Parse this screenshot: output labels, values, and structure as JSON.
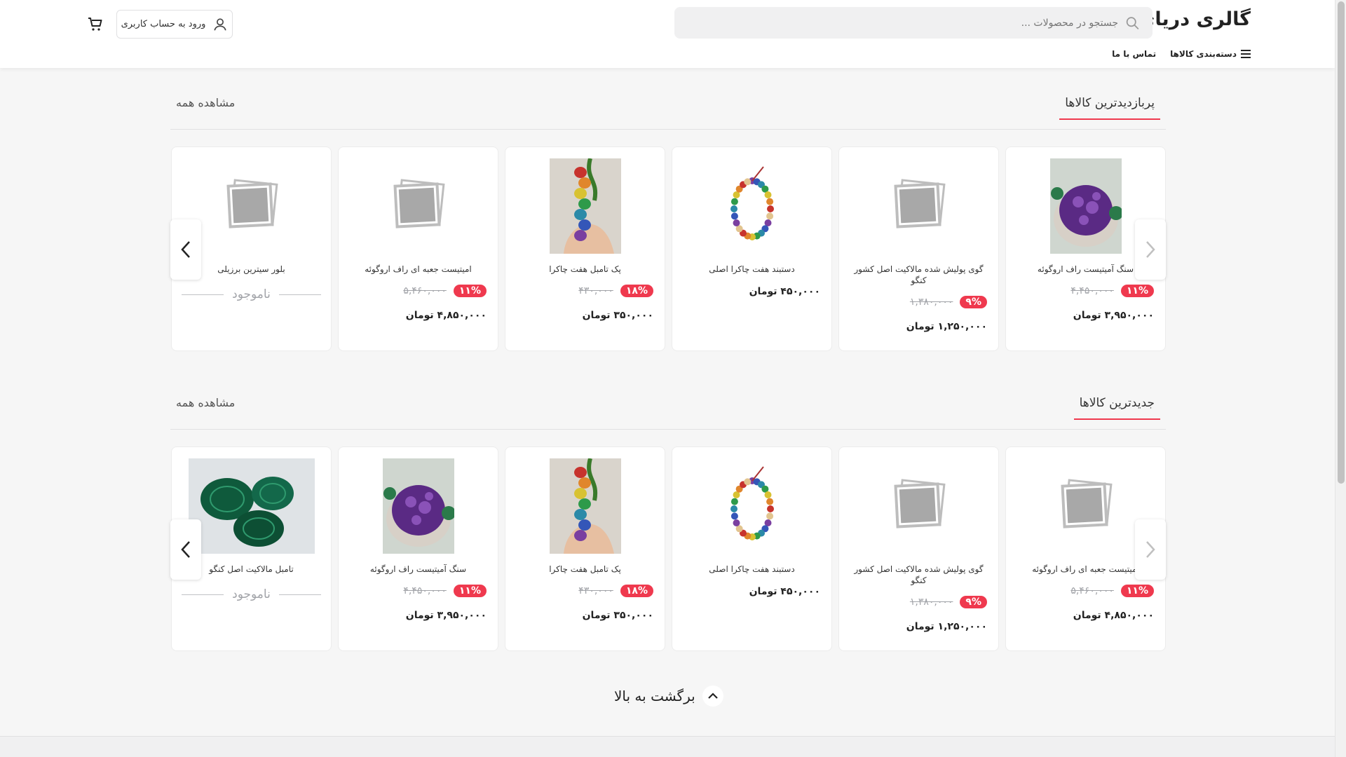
{
  "header": {
    "logo": "گالری دریای نور",
    "search_placeholder": "جستجو در محصولات ...",
    "categories_label": "دسته‌بندی کالاها",
    "contact_label": "تماس با ما",
    "login_label": "ورود به حساب کاربری"
  },
  "sections": [
    {
      "title": "پربازدیدترین کالاها",
      "view_all": "مشاهده همه",
      "products": [
        {
          "name": "سنگ آمیتیست راف اروگوئه",
          "image": "amethyst",
          "discount": "۱۱%",
          "old_price": "۴,۴۵۰,۰۰۰",
          "price": "۳,۹۵۰,۰۰۰ تومان"
        },
        {
          "name": "گوی پولیش شده مالاکیت اصل کشور کنگو",
          "image": "placeholder",
          "discount": "۹%",
          "old_price": "۱,۳۸۰,۰۰۰",
          "price": "۱,۲۵۰,۰۰۰ تومان"
        },
        {
          "name": "دستبند هفت چاکرا اصلی",
          "image": "bracelet",
          "discount": "",
          "old_price": "",
          "price": "۴۵۰,۰۰۰ تومان"
        },
        {
          "name": "پک تامبل هفت چاکرا",
          "image": "chakra",
          "discount": "۱۸%",
          "old_price": "۴۳۰,۰۰۰",
          "price": "۳۵۰,۰۰۰ تومان"
        },
        {
          "name": "امیتیست جعبه ای راف اروگوئه",
          "image": "placeholder",
          "discount": "۱۱%",
          "old_price": "۵,۴۶۰,۰۰۰",
          "price": "۴,۸۵۰,۰۰۰ تومان"
        },
        {
          "name": "بلور سیترین برزیلی",
          "image": "placeholder",
          "out_of_stock": "ناموجود"
        }
      ]
    },
    {
      "title": "جدیدترین کالاها",
      "view_all": "مشاهده همه",
      "products": [
        {
          "name": "امیتیست جعبه ای راف اروگوئه",
          "image": "placeholder",
          "discount": "۱۱%",
          "old_price": "۵,۴۶۰,۰۰۰",
          "price": "۴,۸۵۰,۰۰۰ تومان"
        },
        {
          "name": "گوی پولیش شده مالاکیت اصل کشور کنگو",
          "image": "placeholder",
          "discount": "۹%",
          "old_price": "۱,۳۸۰,۰۰۰",
          "price": "۱,۲۵۰,۰۰۰ تومان"
        },
        {
          "name": "دستبند هفت چاکرا اصلی",
          "image": "bracelet",
          "discount": "",
          "old_price": "",
          "price": "۴۵۰,۰۰۰ تومان"
        },
        {
          "name": "پک تامبل هفت چاکرا",
          "image": "chakra",
          "discount": "۱۸%",
          "old_price": "۴۳۰,۰۰۰",
          "price": "۳۵۰,۰۰۰ تومان"
        },
        {
          "name": "سنگ آمیتیست راف اروگوئه",
          "image": "amethyst",
          "discount": "۱۱%",
          "old_price": "۴,۴۵۰,۰۰۰",
          "price": "۳,۹۵۰,۰۰۰ تومان"
        },
        {
          "name": "تامبل مالاکیت اصل کنگو",
          "image": "malachite",
          "out_of_stock": "ناموجود"
        }
      ]
    }
  ],
  "back_to_top": "برگشت به بالا",
  "colors": {
    "accent": "#ef394e",
    "text": "#222222",
    "muted": "#a1a3a8"
  }
}
